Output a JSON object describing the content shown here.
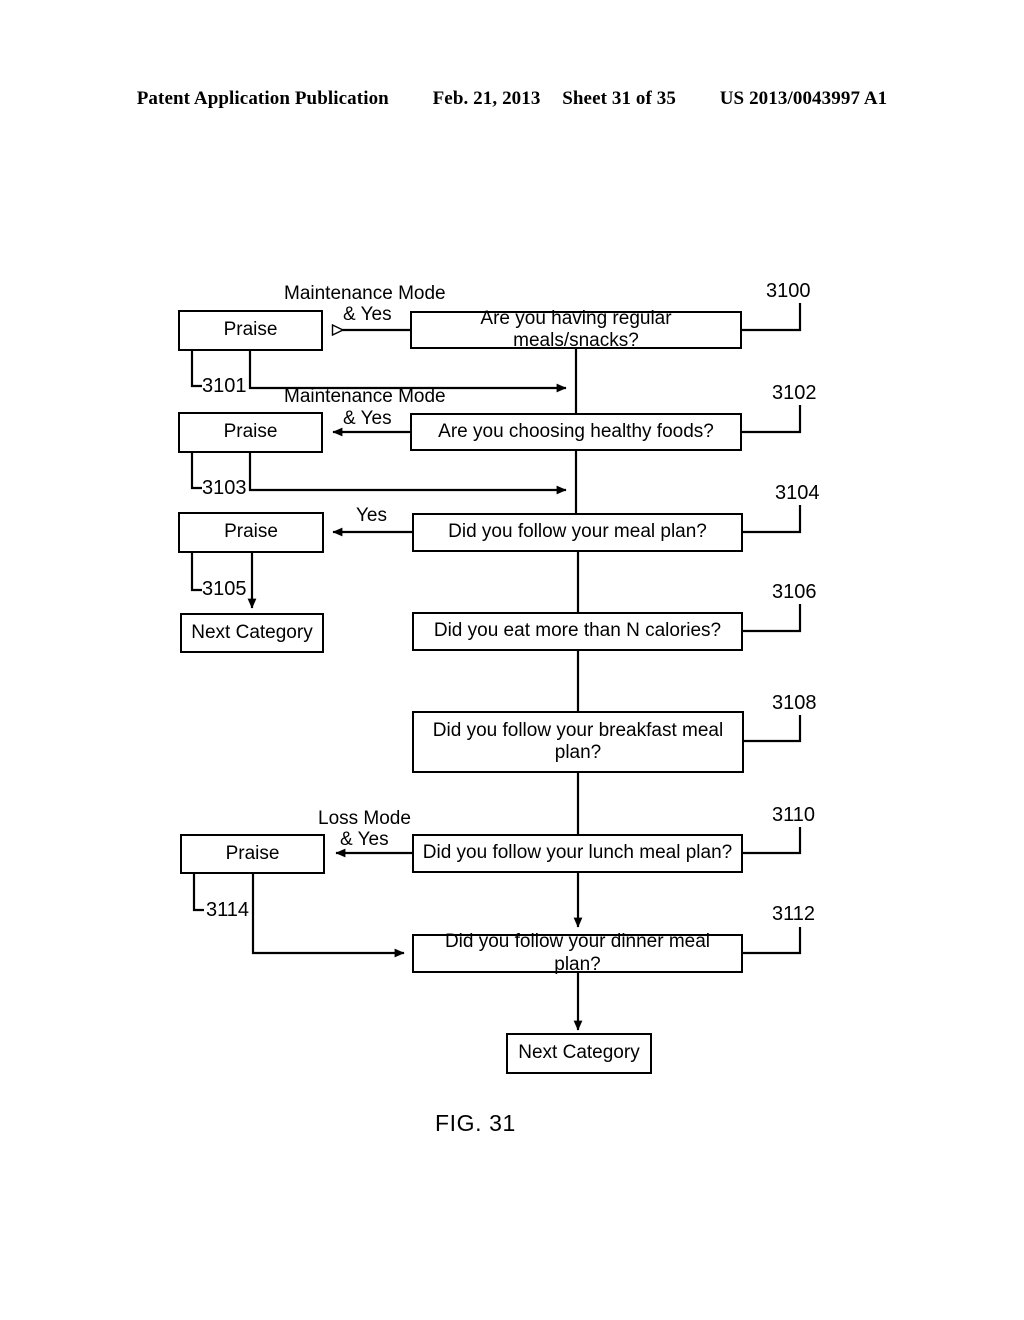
{
  "header": {
    "publication": "Patent Application Publication",
    "date": "Feb. 21, 2013",
    "sheet": "Sheet 31 of 35",
    "patent_number": "US 2013/0043997 A1"
  },
  "figure": {
    "caption": "FIG. 31",
    "nodes": {
      "praise_1": "Praise",
      "question_3100": "Are you having regular meals/snacks?",
      "praise_2": "Praise",
      "question_3102": "Are you choosing healthy foods?",
      "praise_3": "Praise",
      "question_3104": "Did you follow your meal plan?",
      "next_category_left": "Next Category",
      "question_3106": "Did you eat more than N calories?",
      "question_3108": "Did you follow your breakfast meal plan?",
      "praise_4": "Praise",
      "question_3110": "Did you follow your lunch meal plan?",
      "question_3112": "Did you follow your dinner meal plan?",
      "next_category_bottom": "Next Category"
    },
    "edge_labels": {
      "label_1_line1": "Maintenance Mode",
      "label_1_line2": "& Yes",
      "label_2_line1": "Maintenance Mode",
      "label_2_line2": "& Yes",
      "label_3": "Yes",
      "label_4_line1": "Loss Mode",
      "label_4_line2": "& Yes"
    },
    "reference_numerals": {
      "ref_3100": "3100",
      "ref_3101": "3101",
      "ref_3102": "3102",
      "ref_3103": "3103",
      "ref_3104": "3104",
      "ref_3105": "3105",
      "ref_3106": "3106",
      "ref_3108": "3108",
      "ref_3110": "3110",
      "ref_3112": "3112",
      "ref_3114": "3114"
    }
  }
}
